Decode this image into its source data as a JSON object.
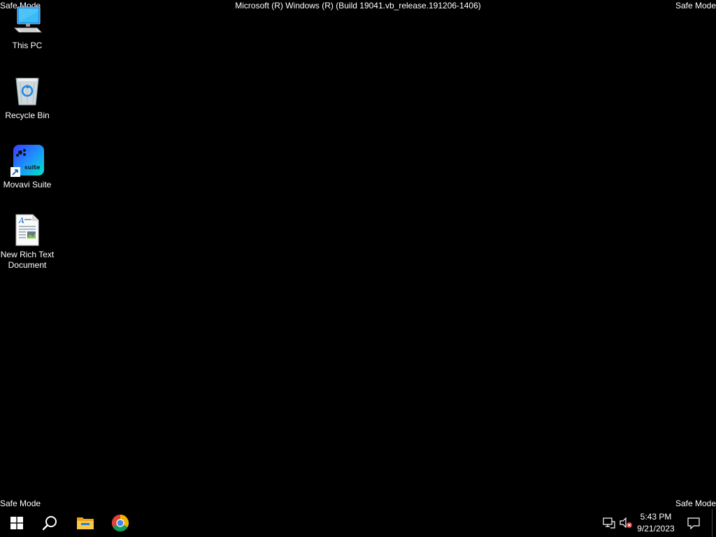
{
  "watermark": {
    "top_left": "Safe Mode",
    "top_right": "Safe Mode",
    "bottom_left": "Safe Mode",
    "bottom_right": "Safe Mode",
    "build": "Microsoft (R) Windows (R) (Build 19041.vb_release.191206-1406)"
  },
  "desktop_icons": [
    {
      "label": "This PC",
      "icon": "this-pc-icon"
    },
    {
      "label": "Recycle Bin",
      "icon": "recycle-bin-icon"
    },
    {
      "label": "Movavi Suite",
      "icon": "movavi-suite-icon",
      "badge_text": "suite"
    },
    {
      "label": "New Rich Text Document",
      "icon": "rich-text-document-icon"
    }
  ],
  "taskbar": {
    "buttons": [
      {
        "name": "start",
        "icon": "windows-logo-icon"
      },
      {
        "name": "search",
        "icon": "search-icon"
      },
      {
        "name": "file-explorer",
        "icon": "folder-icon"
      },
      {
        "name": "chrome",
        "icon": "chrome-icon"
      }
    ],
    "tray": {
      "network_icon": "network-icon",
      "volume_icon": "volume-muted-icon",
      "time": "5:43 PM",
      "date": "9/21/2023",
      "notifications_icon": "action-center-icon"
    }
  },
  "colors": {
    "background": "#000000",
    "text": "#ffffff",
    "accent_blue": "#2d7fd3"
  }
}
